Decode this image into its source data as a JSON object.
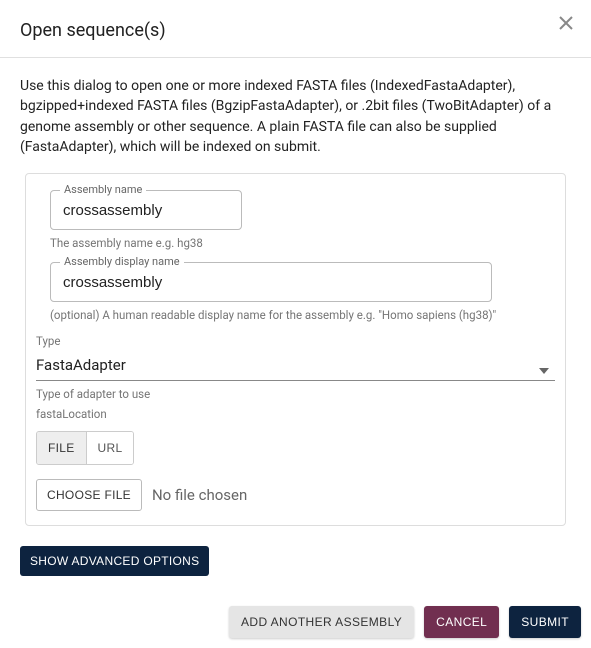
{
  "dialog": {
    "title": "Open sequence(s)",
    "description": "Use this dialog to open one or more indexed FASTA files (IndexedFastaAdapter), bgzipped+indexed FASTA files (BgzipFastaAdapter), or .2bit files (TwoBitAdapter) of a genome assembly or other sequence. A plain FASTA file can also be supplied (FastaAdapter), which will be indexed on submit."
  },
  "assembly": {
    "name_label": "Assembly name",
    "name_value": "crossassembly",
    "name_helper": "The assembly name e.g. hg38",
    "display_label": "Assembly display name",
    "display_value": "crossassembly",
    "display_helper": "(optional) A human readable display name for the assembly e.g. \"Homo sapiens (hg38)\""
  },
  "type": {
    "label": "Type",
    "value": "FastaAdapter",
    "helper": "Type of adapter to use"
  },
  "fasta": {
    "location_label": "fastaLocation",
    "tab_file": "FILE",
    "tab_url": "URL",
    "choose_file": "CHOOSE FILE",
    "no_file": "No file chosen"
  },
  "buttons": {
    "show_advanced": "SHOW ADVANCED OPTIONS",
    "add_another": "ADD ANOTHER ASSEMBLY",
    "cancel": "CANCEL",
    "submit": "SUBMIT"
  }
}
